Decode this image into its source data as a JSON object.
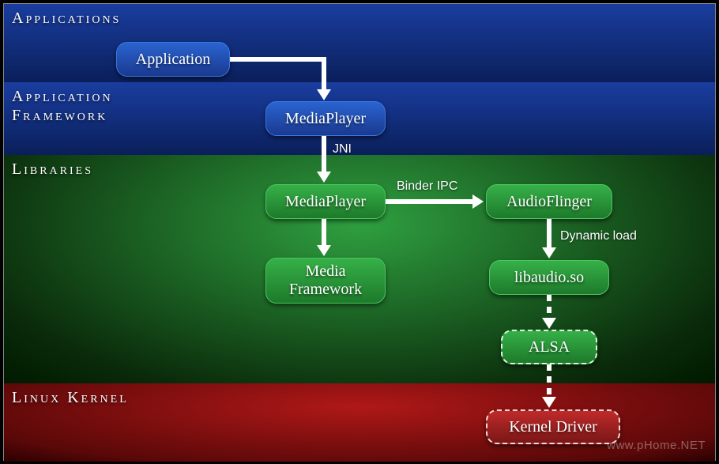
{
  "layers": {
    "applications": "Applications",
    "app_framework": "Application\nFramework",
    "libraries": "Libraries",
    "linux_kernel": "Linux Kernel"
  },
  "nodes": {
    "application": "Application",
    "mediaplayer_java": "MediaPlayer",
    "mediaplayer_native": "MediaPlayer",
    "audioflinger": "AudioFlinger",
    "media_framework": "Media\nFramework",
    "libaudio": "libaudio.so",
    "alsa": "ALSA",
    "kernel_driver": "Kernel Driver"
  },
  "edges": {
    "jni": "JNI",
    "binder_ipc": "Binder IPC",
    "dynamic_load": "Dynamic load"
  },
  "watermark": "www.pHome.NET"
}
